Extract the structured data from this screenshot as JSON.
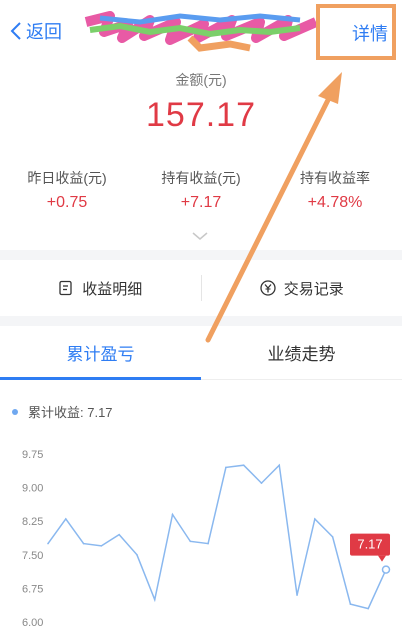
{
  "header": {
    "back_label": "返回",
    "detail_label": "详情"
  },
  "summary": {
    "amount_label": "金额(元)",
    "amount_value": "157.17"
  },
  "stats": [
    {
      "label": "昨日收益(元)",
      "value": "+0.75"
    },
    {
      "label": "持有收益(元)",
      "value": "+7.17"
    },
    {
      "label": "持有收益率",
      "value": "+4.78%"
    }
  ],
  "actions": {
    "income_detail": "收益明细",
    "trade_record": "交易记录"
  },
  "tabs": [
    {
      "label": "累计盈亏",
      "active": true
    },
    {
      "label": "业绩走势",
      "active": false
    }
  ],
  "legend": {
    "label": "累计收益: 7.17"
  },
  "colors": {
    "accent": "#2f7df3",
    "positive": "#e03a45",
    "line": "#8ab8ef",
    "annotation_arrow": "#f0a060"
  },
  "chart_data": {
    "type": "line",
    "y_ticks": [
      "9.75",
      "9.00",
      "8.25",
      "7.50",
      "6.75",
      "6.00"
    ],
    "ylim": [
      6.0,
      9.75
    ],
    "series": [
      {
        "values": [
          7.75,
          8.3,
          7.75,
          7.7,
          7.95,
          7.5,
          6.5,
          8.4,
          7.8,
          7.75,
          9.45,
          9.5,
          9.1,
          9.5,
          6.6,
          8.3,
          7.9,
          6.4,
          6.3,
          7.17
        ]
      }
    ],
    "last_value_label": "7.17"
  }
}
